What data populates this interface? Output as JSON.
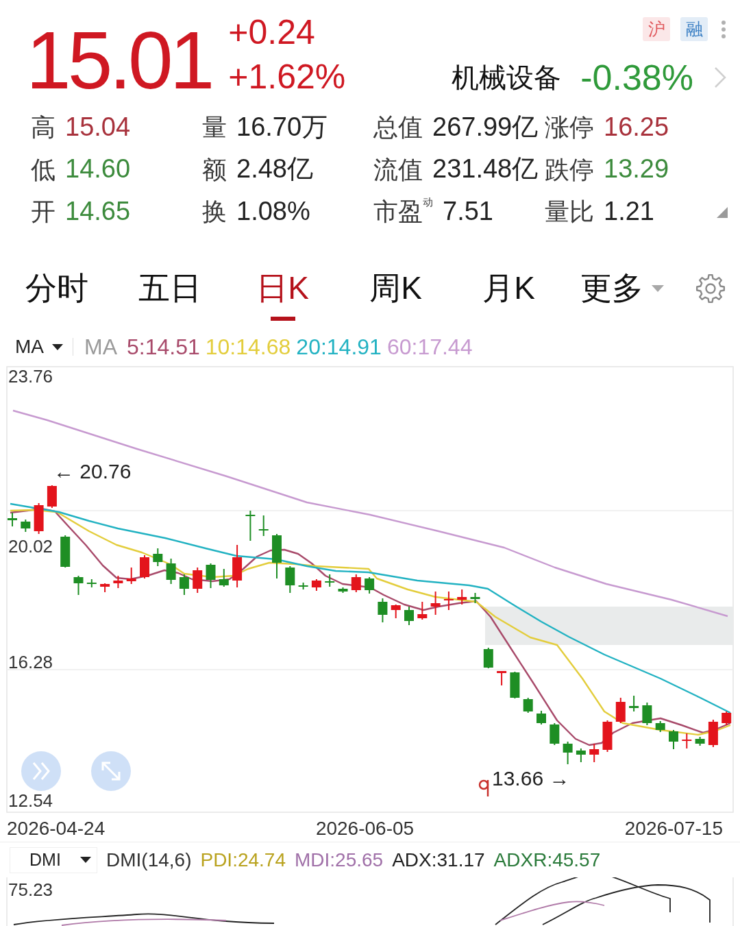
{
  "quote": {
    "price": "15.01",
    "change": "+0.24",
    "change_percent": "+1.62%",
    "up": true
  },
  "badges": [
    {
      "text": "沪",
      "color": "#e0565b"
    },
    {
      "text": "融",
      "color": "#3a7fc4"
    }
  ],
  "sector": {
    "name": "机械设备",
    "change": "-0.38%",
    "up": false
  },
  "stats": [
    {
      "label": "高",
      "value": "15.04",
      "color": "#a8323c"
    },
    {
      "label": "量",
      "value": "16.70万",
      "color": "#222222"
    },
    {
      "label": "总值",
      "value": "267.99亿",
      "color": "#222222"
    },
    {
      "label": "涨停",
      "value": "16.25",
      "color": "#a8323c"
    },
    {
      "label": "低",
      "value": "14.60",
      "color": "#3d8b3d"
    },
    {
      "label": "额",
      "value": "2.48亿",
      "color": "#222222"
    },
    {
      "label": "流值",
      "value": "231.48亿",
      "color": "#222222"
    },
    {
      "label": "跌停",
      "value": "13.29",
      "color": "#3d8b3d"
    },
    {
      "label": "开",
      "value": "14.65",
      "color": "#3d8b3d"
    },
    {
      "label": "换",
      "value": "1.08%",
      "color": "#222222"
    },
    {
      "label": "市盈$^{动}$",
      "value": "7.51",
      "color": "#222222"
    },
    {
      "label": "量比",
      "value": "1.21",
      "color": "#222222"
    }
  ],
  "tabs": [
    {
      "label": "分时",
      "kind": "tab",
      "selected": false
    },
    {
      "label": "五日",
      "kind": "tab",
      "selected": false
    },
    {
      "label": "日K",
      "kind": "tab",
      "selected": true
    },
    {
      "label": "周K",
      "kind": "tab",
      "selected": false
    },
    {
      "label": "月K",
      "kind": "tab",
      "selected": false
    },
    {
      "label": "更多",
      "kind": "menu",
      "selected": false
    }
  ],
  "indicator": {
    "selector": "MA",
    "name": "MA",
    "values": [
      {
        "text": "5:14.51",
        "color": "#a84a6a"
      },
      {
        "text": "10:14.68",
        "color": "#e3cd3c"
      },
      {
        "text": "20:14.91",
        "color": "#22b2c2"
      },
      {
        "text": "60:17.44",
        "color": "#c79ad0"
      }
    ]
  },
  "kline": {
    "y_labels": [
      "23.76",
      "20.02",
      "16.28",
      "12.54"
    ],
    "high_marker": "← 20.76",
    "low_marker": "13.66 →",
    "dates": [
      "2026-04-24",
      "2026-06-05",
      "2026-07-15"
    ]
  },
  "sub_indicator": {
    "selector": "DMI",
    "values": [
      {
        "text": "DMI(14,6)",
        "color": "#333333"
      },
      {
        "text": "PDI:24.74",
        "color": "#b9a21e"
      },
      {
        "text": "MDI:25.65",
        "color": "#a070a8"
      },
      {
        "text": "ADX:31.17",
        "color": "#222222"
      },
      {
        "text": "ADXR:45.57",
        "color": "#2a7a3a"
      }
    ],
    "y_label": "75.23"
  }
}
